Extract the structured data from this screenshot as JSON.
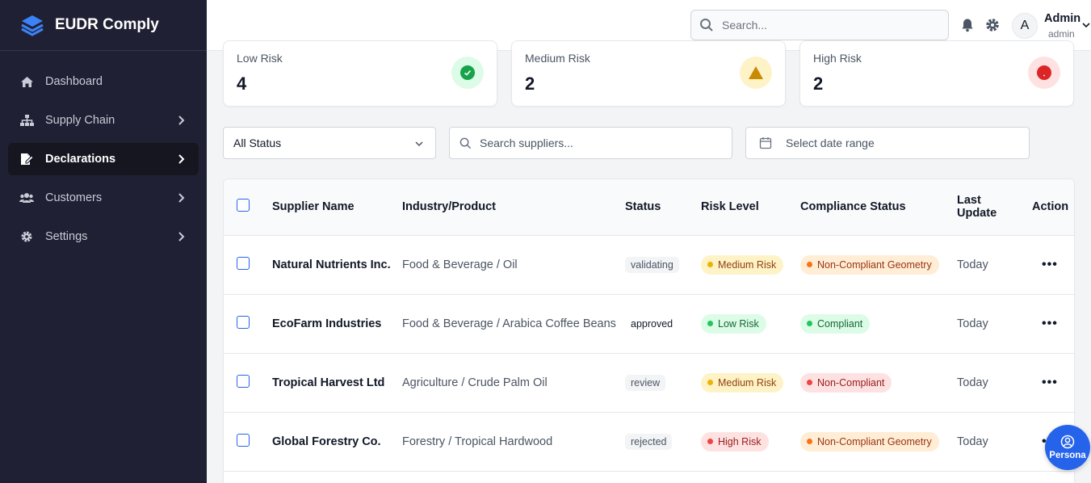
{
  "app": {
    "name": "EUDR Comply"
  },
  "sidebar": {
    "items": [
      {
        "label": "Dashboard",
        "icon": "home-icon"
      },
      {
        "label": "Supply Chain",
        "icon": "sitemap-icon"
      },
      {
        "label": "Declarations",
        "icon": "file-edit-icon",
        "active": true
      },
      {
        "label": "Customers",
        "icon": "users-icon"
      },
      {
        "label": "Settings",
        "icon": "gear-icon"
      }
    ]
  },
  "header": {
    "search_placeholder": "Search...",
    "avatar_initial": "A",
    "user_name": "Admin",
    "user_role": "admin"
  },
  "stats": [
    {
      "label": "Low Risk",
      "value": "4",
      "color": "#16a34a"
    },
    {
      "label": "Medium Risk",
      "value": "2",
      "color": "#ca8a04"
    },
    {
      "label": "High Risk",
      "value": "2",
      "color": "#dc2626"
    }
  ],
  "filters": {
    "status_value": "All Status",
    "supplier_search_placeholder": "Search suppliers...",
    "date_range_placeholder": "Select date range"
  },
  "table": {
    "headers": {
      "supplier": "Supplier Name",
      "industry": "Industry/Product",
      "status": "Status",
      "risk": "Risk Level",
      "compliance": "Compliance Status",
      "last_update_1": "Last",
      "last_update_2": "Update",
      "action": "Action"
    },
    "rows": [
      {
        "supplier": "Natural Nutrients Inc.",
        "industry": "Food & Beverage / Oil",
        "status": "validating",
        "risk": "Medium Risk",
        "compliance": "Non-Compliant Geometry",
        "updated": "Today"
      },
      {
        "supplier": "EcoFarm Industries",
        "industry": "Food & Beverage / Arabica Coffee Beans",
        "status": "approved",
        "risk": "Low Risk",
        "compliance": "Compliant",
        "updated": "Today"
      },
      {
        "supplier": "Tropical Harvest Ltd",
        "industry": "Agriculture / Crude Palm Oil",
        "status": "review",
        "risk": "Medium Risk",
        "compliance": "Non-Compliant",
        "updated": "Today"
      },
      {
        "supplier": "Global Forestry Co.",
        "industry": "Forestry / Tropical Hardwood",
        "status": "rejected",
        "risk": "High Risk",
        "compliance": "Non-Compliant Geometry",
        "updated": "Today"
      }
    ]
  },
  "persona": {
    "label": "Persona"
  },
  "colors": {
    "sidebar_bg": "#1f2033",
    "accent": "#2563eb"
  }
}
